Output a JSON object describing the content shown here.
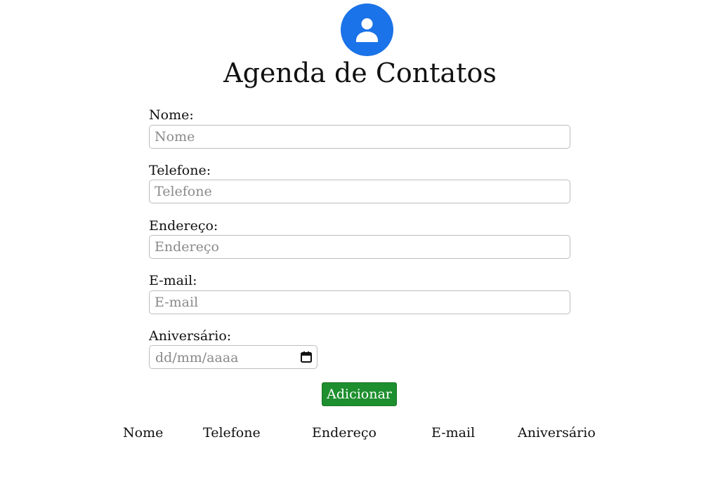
{
  "app": {
    "title": "Agenda de Contatos"
  },
  "colors": {
    "avatar_background": "#1a73e8",
    "button_background": "#1e8f2e",
    "button_text": "#ffffff"
  },
  "icons": {
    "avatar": "person-icon",
    "date_picker": "calendar-icon"
  },
  "form": {
    "nome": {
      "label": "Nome:",
      "placeholder": "Nome",
      "value": ""
    },
    "telefone": {
      "label": "Telefone:",
      "placeholder": "Telefone",
      "value": ""
    },
    "endereco": {
      "label": "Endereço:",
      "placeholder": "Endereço",
      "value": ""
    },
    "email": {
      "label": "E-mail:",
      "placeholder": "E-mail",
      "value": ""
    },
    "aniversario": {
      "label": "Aniversário:",
      "placeholder": "dd/mm/aaaa",
      "value": ""
    },
    "submit_label": "Adicionar"
  },
  "table": {
    "headers": [
      "Nome",
      "Telefone",
      "Endereço",
      "E-mail",
      "Aniversário"
    ],
    "rows": []
  }
}
